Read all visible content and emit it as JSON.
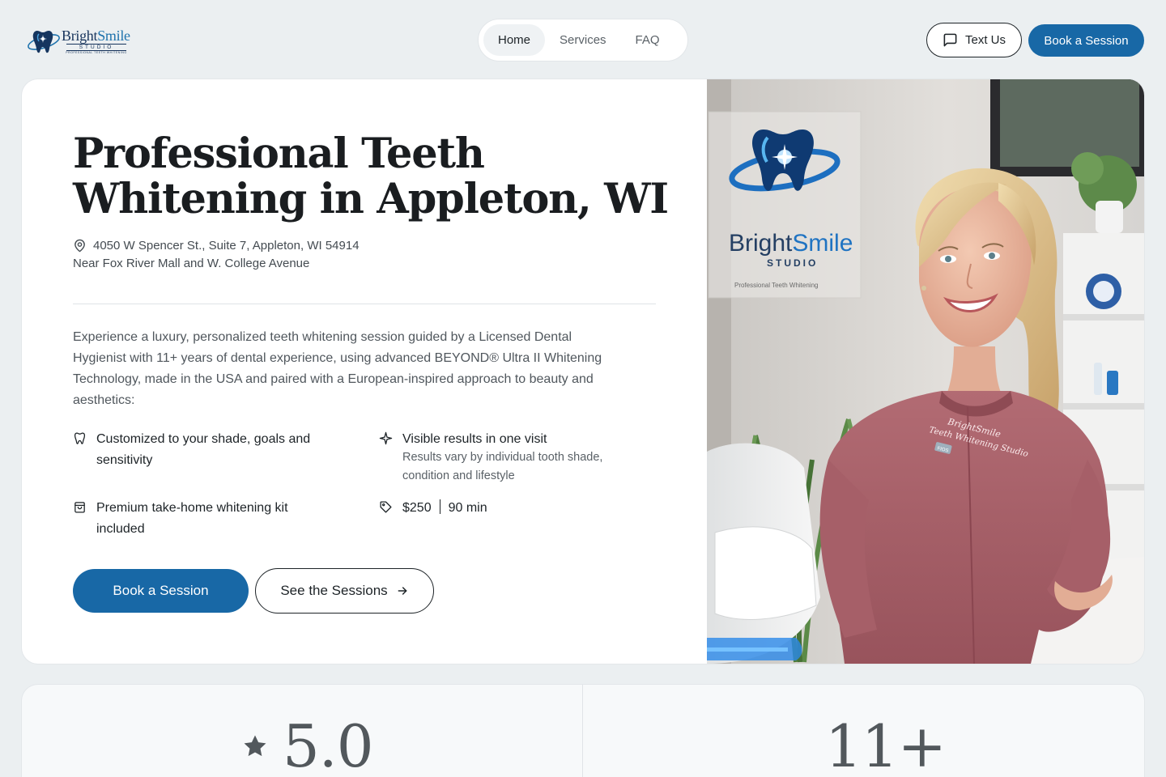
{
  "brand": {
    "name_part1": "Bright",
    "name_part2": "Smile",
    "studio": "STUDIO",
    "tagline": "PROFESSIONAL TEETH WHITENING",
    "colors": {
      "primary": "#1868a6",
      "navy": "#17345c"
    }
  },
  "nav": {
    "items": [
      {
        "label": "Home",
        "active": true
      },
      {
        "label": "Services",
        "active": false
      },
      {
        "label": "FAQ",
        "active": false
      }
    ]
  },
  "header": {
    "text_us_label": "Text Us",
    "text_us_icon": "message-square-icon",
    "book_label": "Book a Session"
  },
  "hero": {
    "title": "Professional Teeth Whitening in Appleton, WI",
    "address_icon": "map-pin-icon",
    "address_line1": "4050 W Spencer St., Suite 7, Appleton, WI 54914",
    "address_line2": "Near Fox River Mall and W. College Avenue",
    "intro": "Experience a luxury, personalized teeth whitening session guided by a Licensed Dental Hygienist with 11+ years of dental experience, using advanced BEYOND® Ultra II Whitening Technology, made in the USA and paired with a European-inspired approach to beauty and aesthetics:",
    "features": [
      {
        "icon": "tooth-icon",
        "text": "Customized to your shade, goals and sensitivity",
        "sub": ""
      },
      {
        "icon": "sparkle-icon",
        "text": "Visible results in one visit",
        "sub": "Results vary by individual tooth shade, condition and lifestyle"
      },
      {
        "icon": "shopping-bag-icon",
        "text": "Premium take-home whitening kit included",
        "sub": ""
      },
      {
        "icon": "price-tag-icon",
        "price": "$250",
        "duration": "90 min"
      }
    ],
    "book_label": "Book a Session",
    "sessions_label": "See the Sessions",
    "sessions_icon": "arrow-right-icon",
    "photo": {
      "sign_name_part1": "Bright",
      "sign_name_part2": "Smile",
      "sign_studio": "STUDIO",
      "sign_tagline": "Professional Teeth Whitening",
      "uniform_line1": "BrightSmile",
      "uniform_line2": "Teeth Whitening Studio",
      "badge_text": "FIOS"
    }
  },
  "stats": [
    {
      "icon": "star-icon",
      "value": "5.0"
    },
    {
      "value": "11+"
    }
  ]
}
